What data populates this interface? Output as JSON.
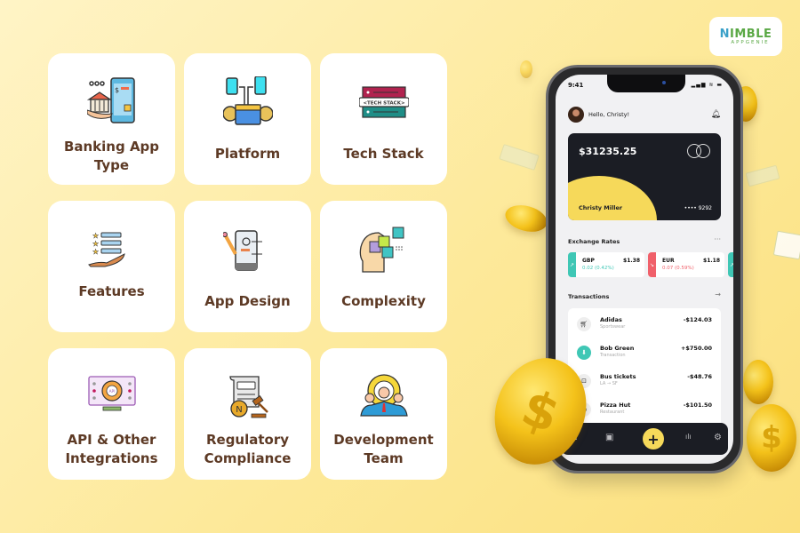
{
  "brand": {
    "logo_prefix": "N",
    "logo_main": "IMBLE",
    "logo_sub": "APPGENIE"
  },
  "factors": [
    {
      "label_line1": "Banking App",
      "label_line2": "Type",
      "icon": "bank-mobile-icon"
    },
    {
      "label_line1": "Platform",
      "label_line2": "",
      "icon": "platform-devices-icon"
    },
    {
      "label_line1": "Tech Stack",
      "label_line2": "",
      "icon": "tech-stack-icon",
      "icon_text": "<TECH STACK>"
    },
    {
      "label_line1": "Features",
      "label_line2": "",
      "icon": "features-list-icon"
    },
    {
      "label_line1": "App Design",
      "label_line2": "",
      "icon": "app-design-icon"
    },
    {
      "label_line1": "Complexity",
      "label_line2": "",
      "icon": "puzzle-head-icon"
    },
    {
      "label_line1": "API & Other",
      "label_line2": "Integrations",
      "icon": "api-gear-icon",
      "icon_text": "API"
    },
    {
      "label_line1": "Regulatory",
      "label_line2": "Compliance",
      "icon": "legal-document-icon"
    },
    {
      "label_line1": "Development",
      "label_line2": "Team",
      "icon": "team-gear-icon"
    }
  ],
  "phone": {
    "status_time": "9:41",
    "status_icons": "▂▄▆ ≋ ▬",
    "greeting": "Hello, Christy!",
    "card": {
      "balance": "$31235.25",
      "holder": "Christy Miller",
      "number": "•••• 9292"
    },
    "exchange": {
      "title": "Exchange Rates",
      "more": "···",
      "rates": [
        {
          "currency": "GBP",
          "value": "$1.38",
          "change": "0.02 (0.42%)",
          "trend": "up",
          "color": "#3fc7b5"
        },
        {
          "currency": "EUR",
          "value": "$1.18",
          "change": "0.07 (0.59%)",
          "trend": "down",
          "color": "#f0606a"
        }
      ]
    },
    "transactions": {
      "title": "Transactions",
      "arrow": "→",
      "items": [
        {
          "name": "Adidas",
          "category": "Sportswear",
          "amount": "-$124.03",
          "icon": "cart-icon"
        },
        {
          "name": "Bob Green",
          "category": "Transaction",
          "amount": "+$750.00",
          "icon": "download-icon"
        },
        {
          "name": "Bus tickets",
          "category": "LA → SF",
          "amount": "-$48.76",
          "icon": "bus-icon"
        },
        {
          "name": "Pizza Hut",
          "category": "Restaurant",
          "amount": "-$101.50",
          "icon": "food-icon"
        }
      ]
    },
    "tabbar": {
      "home": "⌂",
      "wallet": "▣",
      "add": "+",
      "stats": "ılı",
      "settings": "⚙"
    }
  },
  "colors": {
    "background": "#fde99a",
    "label": "#5d3a25",
    "card_dark": "#1b1d24",
    "accent_yellow": "#f6d95a"
  }
}
